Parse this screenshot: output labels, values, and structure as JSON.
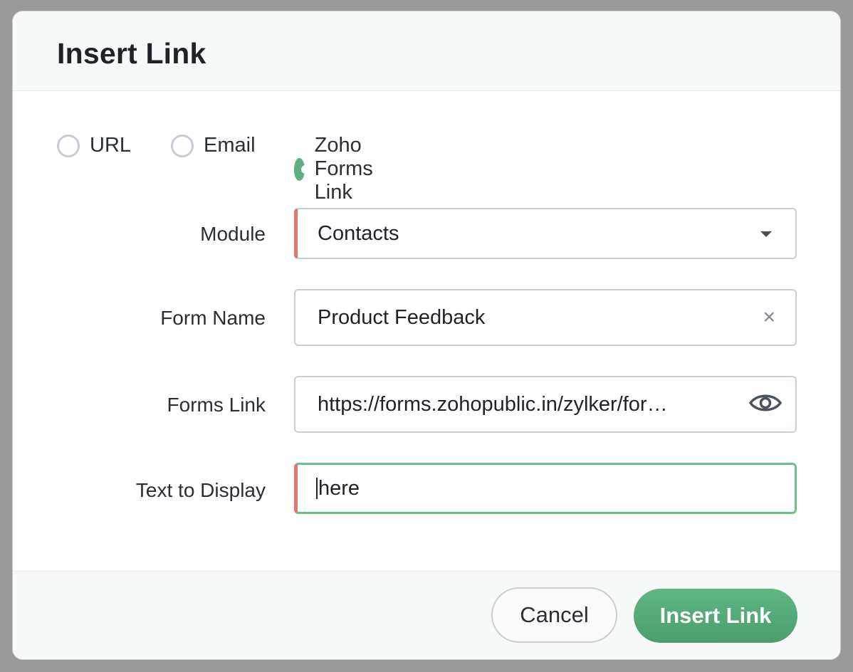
{
  "dialog": {
    "title": "Insert Link"
  },
  "link_type": {
    "options": [
      {
        "label": "URL",
        "checked": false
      },
      {
        "label": "Email",
        "checked": false
      },
      {
        "label": "Zoho Forms Link",
        "checked": true
      }
    ]
  },
  "form": {
    "module": {
      "label": "Module",
      "value": "Contacts",
      "icon": "chevron-down-icon"
    },
    "form_name": {
      "label": "Form Name",
      "value": "Product Feedback",
      "clear_symbol": "×"
    },
    "forms_link": {
      "label": "Forms Link",
      "value": "https://forms.zohopublic.in/zylker/for…",
      "icon": "eye-icon"
    },
    "text_to_display": {
      "label": "Text to Display",
      "value": "here"
    }
  },
  "footer": {
    "cancel_label": "Cancel",
    "insert_label": "Insert Link"
  },
  "colors": {
    "accent_green": "#5cb07b",
    "required_marker": "#e87470",
    "focus_border": "#6cc08c"
  }
}
